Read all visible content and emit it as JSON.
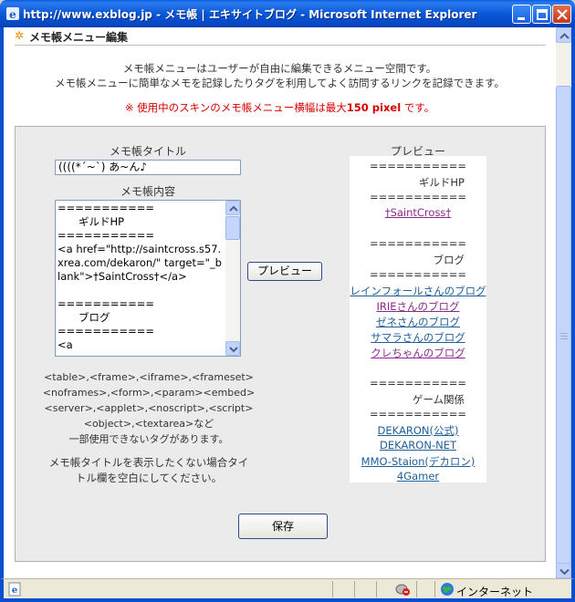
{
  "window": {
    "title": "http://www.exblog.jp - メモ帳 | エキサイトブログ - Microsoft Internet Explorer"
  },
  "page": {
    "section_title": "メモ帳メニュー編集",
    "intro_line1": "メモ帳メニューはユーザーが自由に編集できるメニュー空間です。",
    "intro_line2": "メモ帳メニューに簡単なメモを記録したりタグを利用してよく訪問するリンクを記録できます。",
    "warning_prefix": "※ 使用中のスキンのメモ帳メニュー横幅は最大",
    "warning_value": "150 pixel",
    "warning_suffix": " です。"
  },
  "editor": {
    "title_label": "メモ帳タイトル",
    "title_value": "((((*´~`) あ~ん♪",
    "content_label": "メモ帳内容",
    "content_value": "===========\n　　ギルドHP\n===========\n<a href=\"http://saintcross.s57.xrea.com/dekaron/\" target=\"_blank\">†SaintCross†</a>\n\n===========\n　　ブログ\n===========\n<a",
    "preview_button": "プレビュー",
    "tags_note_line1": "<table>,<frame>,<iframe>,<frameset>",
    "tags_note_line2": "<noframes>,<form>,<param><embed>",
    "tags_note_line3": "<server>,<applet>,<noscript>,<script>",
    "tags_note_line4": "<object>,<textarea>など",
    "tags_note_line5": "一部使用できないタグがあります。",
    "title_note_line1": "メモ帳タイトルを表示したくない場合タイ",
    "title_note_line2": "トル欄を空白にしてください。",
    "save_button": "保存"
  },
  "preview": {
    "label": "プレビュー",
    "divider": "===========",
    "guild_heading": "ギルドHP",
    "guild_link": "†SaintCross†",
    "blog_heading": "ブログ",
    "blog_links": [
      "レインフォールさんのブログ",
      "IRIEさんのブログ",
      "ゼネさんのブログ",
      "サマラさんのブログ",
      "クレちゃんのブログ"
    ],
    "game_heading": "ゲーム関係",
    "game_links": [
      "DEKARON(公式)",
      "DEKARON-NET",
      "MMO-Staion(デカロン)",
      "4Gamer"
    ]
  },
  "statusbar": {
    "zone": "インターネット"
  }
}
